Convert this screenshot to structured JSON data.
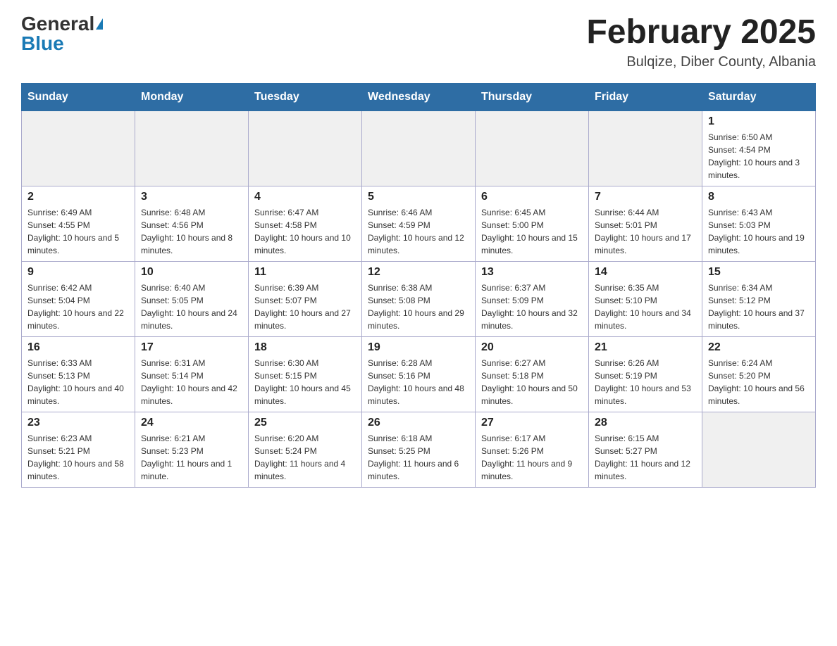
{
  "header": {
    "logo_general": "General",
    "logo_blue": "Blue",
    "month_title": "February 2025",
    "location": "Bulqize, Diber County, Albania"
  },
  "days_of_week": [
    "Sunday",
    "Monday",
    "Tuesday",
    "Wednesday",
    "Thursday",
    "Friday",
    "Saturday"
  ],
  "weeks": [
    [
      {
        "day": "",
        "info": ""
      },
      {
        "day": "",
        "info": ""
      },
      {
        "day": "",
        "info": ""
      },
      {
        "day": "",
        "info": ""
      },
      {
        "day": "",
        "info": ""
      },
      {
        "day": "",
        "info": ""
      },
      {
        "day": "1",
        "info": "Sunrise: 6:50 AM\nSunset: 4:54 PM\nDaylight: 10 hours and 3 minutes."
      }
    ],
    [
      {
        "day": "2",
        "info": "Sunrise: 6:49 AM\nSunset: 4:55 PM\nDaylight: 10 hours and 5 minutes."
      },
      {
        "day": "3",
        "info": "Sunrise: 6:48 AM\nSunset: 4:56 PM\nDaylight: 10 hours and 8 minutes."
      },
      {
        "day": "4",
        "info": "Sunrise: 6:47 AM\nSunset: 4:58 PM\nDaylight: 10 hours and 10 minutes."
      },
      {
        "day": "5",
        "info": "Sunrise: 6:46 AM\nSunset: 4:59 PM\nDaylight: 10 hours and 12 minutes."
      },
      {
        "day": "6",
        "info": "Sunrise: 6:45 AM\nSunset: 5:00 PM\nDaylight: 10 hours and 15 minutes."
      },
      {
        "day": "7",
        "info": "Sunrise: 6:44 AM\nSunset: 5:01 PM\nDaylight: 10 hours and 17 minutes."
      },
      {
        "day": "8",
        "info": "Sunrise: 6:43 AM\nSunset: 5:03 PM\nDaylight: 10 hours and 19 minutes."
      }
    ],
    [
      {
        "day": "9",
        "info": "Sunrise: 6:42 AM\nSunset: 5:04 PM\nDaylight: 10 hours and 22 minutes."
      },
      {
        "day": "10",
        "info": "Sunrise: 6:40 AM\nSunset: 5:05 PM\nDaylight: 10 hours and 24 minutes."
      },
      {
        "day": "11",
        "info": "Sunrise: 6:39 AM\nSunset: 5:07 PM\nDaylight: 10 hours and 27 minutes."
      },
      {
        "day": "12",
        "info": "Sunrise: 6:38 AM\nSunset: 5:08 PM\nDaylight: 10 hours and 29 minutes."
      },
      {
        "day": "13",
        "info": "Sunrise: 6:37 AM\nSunset: 5:09 PM\nDaylight: 10 hours and 32 minutes."
      },
      {
        "day": "14",
        "info": "Sunrise: 6:35 AM\nSunset: 5:10 PM\nDaylight: 10 hours and 34 minutes."
      },
      {
        "day": "15",
        "info": "Sunrise: 6:34 AM\nSunset: 5:12 PM\nDaylight: 10 hours and 37 minutes."
      }
    ],
    [
      {
        "day": "16",
        "info": "Sunrise: 6:33 AM\nSunset: 5:13 PM\nDaylight: 10 hours and 40 minutes."
      },
      {
        "day": "17",
        "info": "Sunrise: 6:31 AM\nSunset: 5:14 PM\nDaylight: 10 hours and 42 minutes."
      },
      {
        "day": "18",
        "info": "Sunrise: 6:30 AM\nSunset: 5:15 PM\nDaylight: 10 hours and 45 minutes."
      },
      {
        "day": "19",
        "info": "Sunrise: 6:28 AM\nSunset: 5:16 PM\nDaylight: 10 hours and 48 minutes."
      },
      {
        "day": "20",
        "info": "Sunrise: 6:27 AM\nSunset: 5:18 PM\nDaylight: 10 hours and 50 minutes."
      },
      {
        "day": "21",
        "info": "Sunrise: 6:26 AM\nSunset: 5:19 PM\nDaylight: 10 hours and 53 minutes."
      },
      {
        "day": "22",
        "info": "Sunrise: 6:24 AM\nSunset: 5:20 PM\nDaylight: 10 hours and 56 minutes."
      }
    ],
    [
      {
        "day": "23",
        "info": "Sunrise: 6:23 AM\nSunset: 5:21 PM\nDaylight: 10 hours and 58 minutes."
      },
      {
        "day": "24",
        "info": "Sunrise: 6:21 AM\nSunset: 5:23 PM\nDaylight: 11 hours and 1 minute."
      },
      {
        "day": "25",
        "info": "Sunrise: 6:20 AM\nSunset: 5:24 PM\nDaylight: 11 hours and 4 minutes."
      },
      {
        "day": "26",
        "info": "Sunrise: 6:18 AM\nSunset: 5:25 PM\nDaylight: 11 hours and 6 minutes."
      },
      {
        "day": "27",
        "info": "Sunrise: 6:17 AM\nSunset: 5:26 PM\nDaylight: 11 hours and 9 minutes."
      },
      {
        "day": "28",
        "info": "Sunrise: 6:15 AM\nSunset: 5:27 PM\nDaylight: 11 hours and 12 minutes."
      },
      {
        "day": "",
        "info": ""
      }
    ]
  ]
}
